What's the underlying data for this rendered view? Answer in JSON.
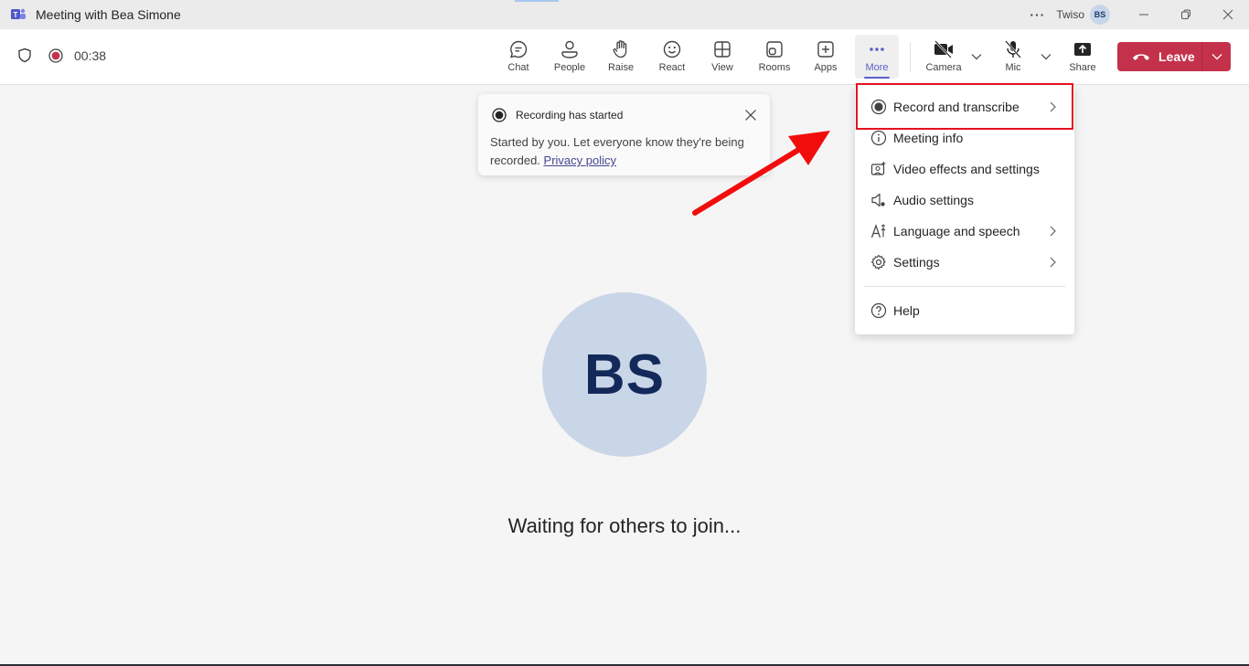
{
  "window": {
    "title": "Meeting with Bea Simone",
    "more_glyph": "···",
    "org_name": "Twiso",
    "user_initials": "BS",
    "minimize_label": "Minimize",
    "restore_label": "Restore",
    "close_label": "Close"
  },
  "meeting": {
    "elapsed": "00:38",
    "recording": true
  },
  "toolbar": {
    "buttons": [
      {
        "id": "chat",
        "label": "Chat",
        "icon": "chat-icon"
      },
      {
        "id": "people",
        "label": "People",
        "icon": "people-icon"
      },
      {
        "id": "raise",
        "label": "Raise",
        "icon": "hand-icon"
      },
      {
        "id": "react",
        "label": "React",
        "icon": "smiley-icon"
      },
      {
        "id": "view",
        "label": "View",
        "icon": "grid-icon"
      },
      {
        "id": "rooms",
        "label": "Rooms",
        "icon": "rooms-icon"
      },
      {
        "id": "apps",
        "label": "Apps",
        "icon": "plus-box-icon"
      },
      {
        "id": "more",
        "label": "More",
        "icon": "ellipsis-icon",
        "active": true
      },
      {
        "id": "camera",
        "label": "Camera",
        "icon": "camera-off-icon"
      },
      {
        "id": "mic",
        "label": "Mic",
        "icon": "mic-off-icon"
      },
      {
        "id": "share",
        "label": "Share",
        "icon": "share-icon"
      }
    ],
    "leave_label": "Leave",
    "leave_color": "#c4314b",
    "accent_color": "#5b5fc7"
  },
  "toast": {
    "title": "Recording has started",
    "body": "Started by you. Let everyone know they're being recorded.",
    "link": "Privacy policy"
  },
  "more_menu": {
    "items": [
      {
        "label": "Record and transcribe",
        "icon": "record-icon",
        "submenu": true,
        "highlighted": true
      },
      {
        "label": "Meeting info",
        "icon": "info-icon",
        "submenu": false
      },
      {
        "label": "Video effects and settings",
        "icon": "video-effects-icon",
        "submenu": false
      },
      {
        "label": "Audio settings",
        "icon": "audio-settings-icon",
        "submenu": false
      },
      {
        "label": "Language and speech",
        "icon": "language-icon",
        "submenu": true
      },
      {
        "label": "Settings",
        "icon": "gear-icon",
        "submenu": true
      },
      {
        "label": "Help",
        "icon": "help-icon",
        "submenu": false
      }
    ]
  },
  "stage": {
    "participant_initials": "BS",
    "status": "Waiting for others to join..."
  },
  "annotation": {
    "color": "#e4121f"
  }
}
